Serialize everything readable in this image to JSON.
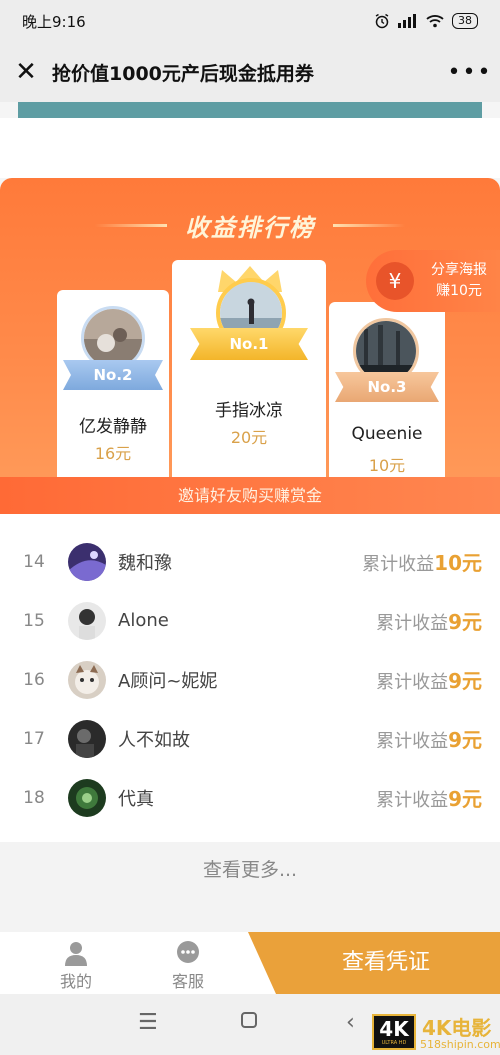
{
  "status_bar": {
    "time": "晚上9:16",
    "battery": "38"
  },
  "nav": {
    "title": "抢价值1000元产后现金抵用券",
    "more": "•••",
    "close": "✕"
  },
  "ranking": {
    "title": "收益排行榜",
    "top3": [
      {
        "rank_label": "No.2",
        "name": "亿发静静",
        "amount": "16元"
      },
      {
        "rank_label": "No.1",
        "name": "手指冰凉",
        "amount": "20元"
      },
      {
        "rank_label": "No.3",
        "name": "Queenie",
        "amount": "10元"
      }
    ],
    "share": {
      "line1": "分享海报",
      "line2": "赚10元"
    },
    "invite": "邀请好友购买赚赏金"
  },
  "list": [
    {
      "rank": "14",
      "name": "魏和豫",
      "earn_label": "累计收益",
      "earn_value": "10元",
      "avatar": "purple"
    },
    {
      "rank": "15",
      "name": "Alone",
      "earn_label": "累计收益",
      "earn_value": "9元",
      "avatar": "white"
    },
    {
      "rank": "16",
      "name": "A顾问~妮妮",
      "earn_label": "累计收益",
      "earn_value": "9元",
      "avatar": "cat"
    },
    {
      "rank": "17",
      "name": "人不如故",
      "earn_label": "累计收益",
      "earn_value": "9元",
      "avatar": "dark"
    },
    {
      "rank": "18",
      "name": "代真",
      "earn_label": "累计收益",
      "earn_value": "9元",
      "avatar": "green"
    }
  ],
  "more": "查看更多...",
  "bottom": {
    "tab_me": "我的",
    "tab_service": "客服",
    "voucher": "查看凭证"
  },
  "watermark": {
    "box": "4K",
    "box_sub": "ULTRA HD",
    "title": "4K电影",
    "site": "518shipin.com"
  },
  "colors": {
    "accent": "#ff7a3a",
    "gold": "#e9a133",
    "teal": "#5e9da3"
  }
}
